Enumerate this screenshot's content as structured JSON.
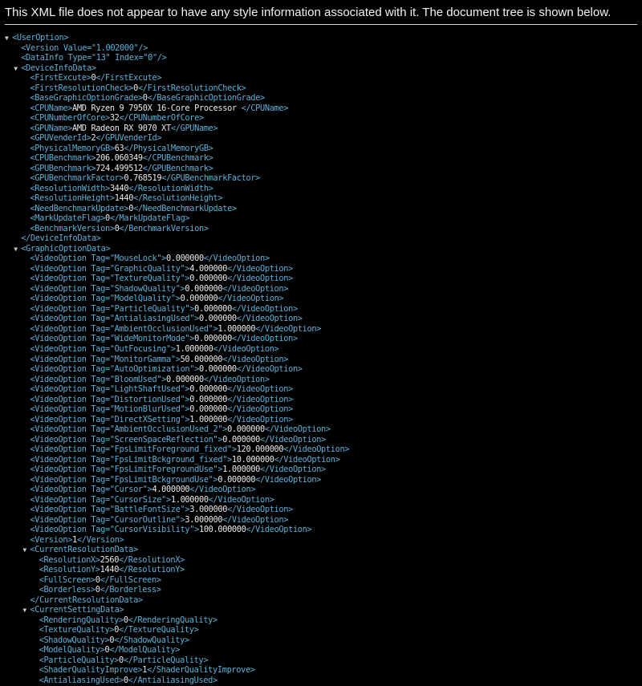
{
  "info_message": "This XML file does not appear to have any style information associated with it. The document tree is shown below.",
  "lines": [
    {
      "d": 0,
      "tog": "▼",
      "open": "<UserOption>",
      "text": "",
      "close": ""
    },
    {
      "d": 1,
      "tog": "",
      "open": "<Version Value=\"1.002000\"/>",
      "text": "",
      "close": ""
    },
    {
      "d": 1,
      "tog": "",
      "open": "<DataInfo Type=\"13\" Index=\"0\"/>",
      "text": "",
      "close": ""
    },
    {
      "d": 1,
      "tog": "▼",
      "open": "<DeviceInfoData>",
      "text": "",
      "close": ""
    },
    {
      "d": 2,
      "tog": "",
      "open": "<FirstExcute>",
      "text": "0",
      "close": "</FirstExcute>"
    },
    {
      "d": 2,
      "tog": "",
      "open": "<FirstResolutionCheck>",
      "text": "0",
      "close": "</FirstResolutionCheck>"
    },
    {
      "d": 2,
      "tog": "",
      "open": "<BaseGraphicOptionGrade>",
      "text": "0",
      "close": "</BaseGraphicOptionGrade>"
    },
    {
      "d": 2,
      "tog": "",
      "open": "<CPUName>",
      "text": "AMD Ryzen 9 7950X 16-Core Processor ",
      "close": "</CPUName>"
    },
    {
      "d": 2,
      "tog": "",
      "open": "<CPUNumberOfCore>",
      "text": "32",
      "close": "</CPUNumberOfCore>"
    },
    {
      "d": 2,
      "tog": "",
      "open": "<GPUName>",
      "text": "AMD Radeon RX 9070 XT",
      "close": "</GPUName>"
    },
    {
      "d": 2,
      "tog": "",
      "open": "<GPUVenderId>",
      "text": "2",
      "close": "</GPUVenderId>"
    },
    {
      "d": 2,
      "tog": "",
      "open": "<PhysicalMemoryGB>",
      "text": "63",
      "close": "</PhysicalMemoryGB>"
    },
    {
      "d": 2,
      "tog": "",
      "open": "<CPUBenchmark>",
      "text": "206.060349",
      "close": "</CPUBenchmark>"
    },
    {
      "d": 2,
      "tog": "",
      "open": "<GPUBenchmark>",
      "text": "724.499512",
      "close": "</GPUBenchmark>"
    },
    {
      "d": 2,
      "tog": "",
      "open": "<GPUBenchmarkFactor>",
      "text": "0.768519",
      "close": "</GPUBenchmarkFactor>"
    },
    {
      "d": 2,
      "tog": "",
      "open": "<ResolutionWidth>",
      "text": "3440",
      "close": "</ResolutionWidth>"
    },
    {
      "d": 2,
      "tog": "",
      "open": "<ResolutionHeight>",
      "text": "1440",
      "close": "</ResolutionHeight>"
    },
    {
      "d": 2,
      "tog": "",
      "open": "<NeedBenchmarkUpdate>",
      "text": "0",
      "close": "</NeedBenchmarkUpdate>"
    },
    {
      "d": 2,
      "tog": "",
      "open": "<MarkUpdateFlag>",
      "text": "0",
      "close": "</MarkUpdateFlag>"
    },
    {
      "d": 2,
      "tog": "",
      "open": "<BenchmarkVersion>",
      "text": "0",
      "close": "</BenchmarkVersion>"
    },
    {
      "d": 1,
      "tog": "",
      "open": "</DeviceInfoData>",
      "text": "",
      "close": ""
    },
    {
      "d": 1,
      "tog": "▼",
      "open": "<GraphicOptionData>",
      "text": "",
      "close": ""
    },
    {
      "d": 2,
      "tog": "",
      "open": "<VideoOption Tag=\"MouseLock\">",
      "text": "0.000000",
      "close": "</VideoOption>"
    },
    {
      "d": 2,
      "tog": "",
      "open": "<VideoOption Tag=\"GraphicQuality\">",
      "text": "4.000000",
      "close": "</VideoOption>"
    },
    {
      "d": 2,
      "tog": "",
      "open": "<VideoOption Tag=\"TextureQuality\">",
      "text": "0.000000",
      "close": "</VideoOption>"
    },
    {
      "d": 2,
      "tog": "",
      "open": "<VideoOption Tag=\"ShadowQuality\">",
      "text": "0.000000",
      "close": "</VideoOption>"
    },
    {
      "d": 2,
      "tog": "",
      "open": "<VideoOption Tag=\"ModelQuality\">",
      "text": "0.000000",
      "close": "</VideoOption>"
    },
    {
      "d": 2,
      "tog": "",
      "open": "<VideoOption Tag=\"ParticleQuality\">",
      "text": "0.000000",
      "close": "</VideoOption>"
    },
    {
      "d": 2,
      "tog": "",
      "open": "<VideoOption Tag=\"AntialiasingUsed\">",
      "text": "0.000000",
      "close": "</VideoOption>"
    },
    {
      "d": 2,
      "tog": "",
      "open": "<VideoOption Tag=\"AmbientOcclusionUsed\">",
      "text": "1.000000",
      "close": "</VideoOption>"
    },
    {
      "d": 2,
      "tog": "",
      "open": "<VideoOption Tag=\"WideMonitorMode\">",
      "text": "0.000000",
      "close": "</VideoOption>"
    },
    {
      "d": 2,
      "tog": "",
      "open": "<VideoOption Tag=\"OutFocusing\">",
      "text": "1.000000",
      "close": "</VideoOption>"
    },
    {
      "d": 2,
      "tog": "",
      "open": "<VideoOption Tag=\"MonitorGamma\">",
      "text": "50.000000",
      "close": "</VideoOption>"
    },
    {
      "d": 2,
      "tog": "",
      "open": "<VideoOption Tag=\"AutoOptimization\">",
      "text": "0.000000",
      "close": "</VideoOption>"
    },
    {
      "d": 2,
      "tog": "",
      "open": "<VideoOption Tag=\"BloomUsed\">",
      "text": "0.000000",
      "close": "</VideoOption>"
    },
    {
      "d": 2,
      "tog": "",
      "open": "<VideoOption Tag=\"LightShaftUsed\">",
      "text": "0.000000",
      "close": "</VideoOption>"
    },
    {
      "d": 2,
      "tog": "",
      "open": "<VideoOption Tag=\"DistortionUsed\">",
      "text": "0.000000",
      "close": "</VideoOption>"
    },
    {
      "d": 2,
      "tog": "",
      "open": "<VideoOption Tag=\"MotionBlurUsed\">",
      "text": "0.000000",
      "close": "</VideoOption>"
    },
    {
      "d": 2,
      "tog": "",
      "open": "<VideoOption Tag=\"DirectXSetting\">",
      "text": "1.000000",
      "close": "</VideoOption>"
    },
    {
      "d": 2,
      "tog": "",
      "open": "<VideoOption Tag=\"AmbientOcclusionUsed_2\">",
      "text": "0.000000",
      "close": "</VideoOption>"
    },
    {
      "d": 2,
      "tog": "",
      "open": "<VideoOption Tag=\"ScreenSpaceReflection\">",
      "text": "0.000000",
      "close": "</VideoOption>"
    },
    {
      "d": 2,
      "tog": "",
      "open": "<VideoOption Tag=\"FpsLimitForeground_fixed\">",
      "text": "120.000000",
      "close": "</VideoOption>"
    },
    {
      "d": 2,
      "tog": "",
      "open": "<VideoOption Tag=\"FpsLimitBckground_fixed\">",
      "text": "10.000000",
      "close": "</VideoOption>"
    },
    {
      "d": 2,
      "tog": "",
      "open": "<VideoOption Tag=\"FpsLimitForegroundUse\">",
      "text": "1.000000",
      "close": "</VideoOption>"
    },
    {
      "d": 2,
      "tog": "",
      "open": "<VideoOption Tag=\"FpsLimitBckgroundUse\">",
      "text": "0.000000",
      "close": "</VideoOption>"
    },
    {
      "d": 2,
      "tog": "",
      "open": "<VideoOption Tag=\"Cursor\">",
      "text": "4.000000",
      "close": "</VideoOption>"
    },
    {
      "d": 2,
      "tog": "",
      "open": "<VideoOption Tag=\"CursorSize\">",
      "text": "1.000000",
      "close": "</VideoOption>"
    },
    {
      "d": 2,
      "tog": "",
      "open": "<VideoOption Tag=\"BattleFontSize\">",
      "text": "3.000000",
      "close": "</VideoOption>"
    },
    {
      "d": 2,
      "tog": "",
      "open": "<VideoOption Tag=\"CursorOutline\">",
      "text": "3.000000",
      "close": "</VideoOption>"
    },
    {
      "d": 2,
      "tog": "",
      "open": "<VideoOption Tag=\"CursorVisibility\">",
      "text": "100.000000",
      "close": "</VideoOption>"
    },
    {
      "d": 2,
      "tog": "",
      "open": "<Version>",
      "text": "1",
      "close": "</Version>"
    },
    {
      "d": 2,
      "tog": "▼",
      "open": "<CurrentResolutionData>",
      "text": "",
      "close": ""
    },
    {
      "d": 3,
      "tog": "",
      "open": "<ResolutionX>",
      "text": "2560",
      "close": "</ResolutionX>"
    },
    {
      "d": 3,
      "tog": "",
      "open": "<ResolutionY>",
      "text": "1440",
      "close": "</ResolutionY>"
    },
    {
      "d": 3,
      "tog": "",
      "open": "<FullScreen>",
      "text": "0",
      "close": "</FullScreen>"
    },
    {
      "d": 3,
      "tog": "",
      "open": "<Borderless>",
      "text": "0",
      "close": "</Borderless>"
    },
    {
      "d": 2,
      "tog": "",
      "open": "</CurrentResolutionData>",
      "text": "",
      "close": ""
    },
    {
      "d": 2,
      "tog": "▼",
      "open": "<CurrentSettingData>",
      "text": "",
      "close": ""
    },
    {
      "d": 3,
      "tog": "",
      "open": "<RenderingQuality>",
      "text": "0",
      "close": "</RenderingQuality>"
    },
    {
      "d": 3,
      "tog": "",
      "open": "<TextureQuality>",
      "text": "0",
      "close": "</TextureQuality>"
    },
    {
      "d": 3,
      "tog": "",
      "open": "<ShadowQuality>",
      "text": "0",
      "close": "</ShadowQuality>"
    },
    {
      "d": 3,
      "tog": "",
      "open": "<ModelQuality>",
      "text": "0",
      "close": "</ModelQuality>"
    },
    {
      "d": 3,
      "tog": "",
      "open": "<ParticleQuality>",
      "text": "0",
      "close": "</ParticleQuality>"
    },
    {
      "d": 3,
      "tog": "",
      "open": "<ShaderQualityImprove>",
      "text": "1",
      "close": "</ShaderQualityImprove>"
    },
    {
      "d": 3,
      "tog": "",
      "open": "<AntialiasingUsed>",
      "text": "0",
      "close": "</AntialiasingUsed>"
    }
  ]
}
